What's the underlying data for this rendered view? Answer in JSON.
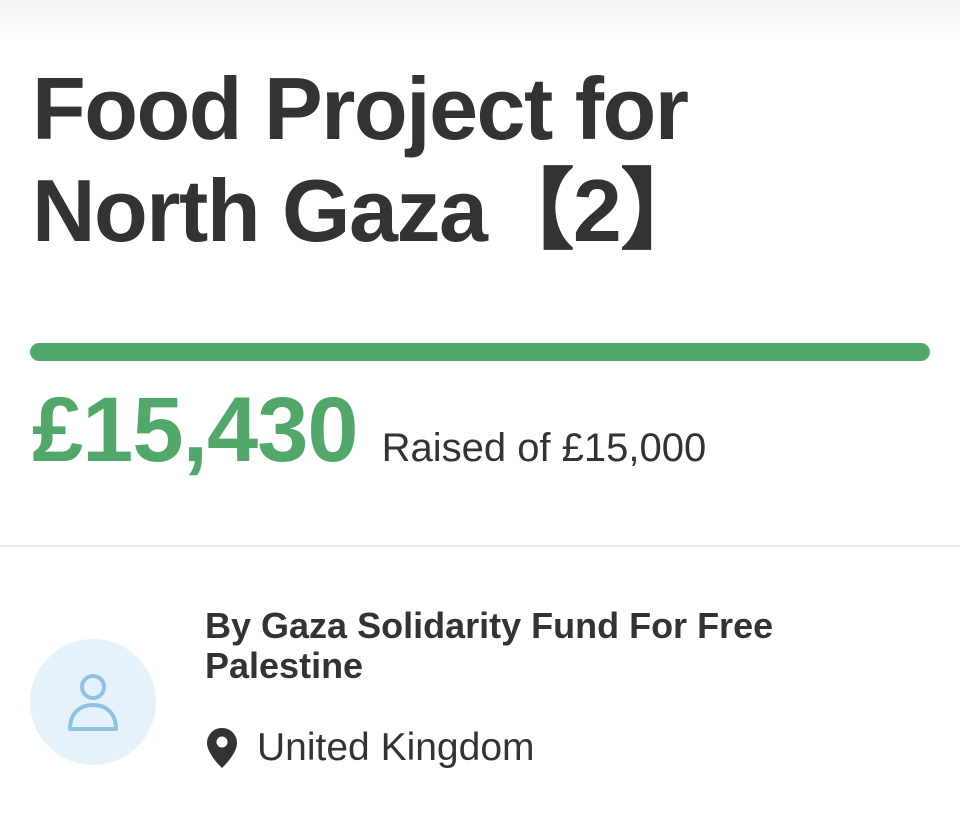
{
  "campaign": {
    "title": "Food Project for North Gaza【2】",
    "raised": "£15,430",
    "target_text": "Raised of £15,000",
    "progress_fraction": 1.0,
    "organizer": "By Gaza Solidarity Fund For Free Palestine",
    "location": "United Kingdom"
  },
  "colors": {
    "accent": "#52a86b",
    "text": "#333333",
    "avatar_bg": "#e6f2fa",
    "avatar_icon": "#8ec3e6"
  },
  "icons": {
    "avatar": "user-icon",
    "location": "map-pin-icon"
  }
}
